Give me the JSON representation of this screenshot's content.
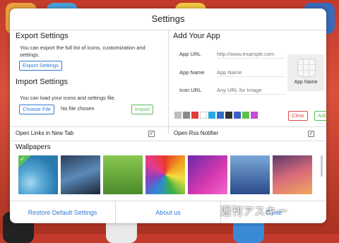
{
  "modal": {
    "title": "Settings"
  },
  "export_section": {
    "heading": "Export Settings",
    "description": "You can export the full list of icons, customization and settings.",
    "button": "Export Settings"
  },
  "import_section": {
    "heading": "Import Settings",
    "description": "You can load your icons and settings file.",
    "choose_button": "Choose File",
    "file_status": "No file chosen",
    "import_button": "Import"
  },
  "add_app": {
    "heading": "Add Your App",
    "url_label": "App URL",
    "url_placeholder": "http://www.example.com",
    "name_label": "App Name",
    "name_placeholder": "App Name",
    "icon_label": "Icon URL",
    "icon_placeholder": "Any URL for Image",
    "preview_label": "App Name",
    "clear_button": "Clear",
    "add_button": "Add",
    "swatch_colors": [
      "#bdbdbd",
      "#8a8a8a",
      "#e03c3c",
      "#ffffff",
      "#29a9e0",
      "#2f6fc9",
      "#333333",
      "#3a5fc8",
      "#5bc24a",
      "#c64ad6"
    ]
  },
  "options": {
    "open_links_label": "Open Links in New Tab",
    "open_links_checked": true,
    "rss_label": "Open Rss Notifier",
    "rss_checked": true
  },
  "wallpapers": {
    "heading": "Wallpapers",
    "selected_index": 0
  },
  "footer": {
    "restore": "Restore Default Settings",
    "about": "About us",
    "close": "Close"
  },
  "watermark": "週刊アスキー"
}
